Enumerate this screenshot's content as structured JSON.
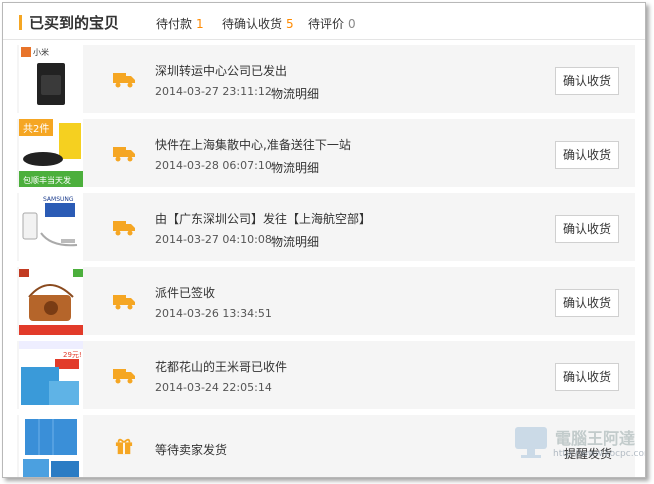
{
  "header": {
    "title": "已买到的宝贝",
    "tabs": [
      {
        "label": "待付款",
        "count": "1"
      },
      {
        "label": "待确认收货",
        "count": "5"
      },
      {
        "label": "待评价",
        "count": "0"
      }
    ]
  },
  "orders": [
    {
      "status": "深圳转运中心公司已发出",
      "time": "2014-03-27 23:11:12",
      "detail": "物流明细",
      "action": "确认收货",
      "icon": "truck-icon",
      "thumb_label": "小米"
    },
    {
      "status": "快件在上海集散中心,准备送往下一站",
      "time": "2014-03-28 06:07:10",
      "detail": "物流明细",
      "action": "确认收货",
      "icon": "truck-icon",
      "thumb_badge": "共2件",
      "thumb_label": "包顺丰当天发"
    },
    {
      "status": "由【广东深圳公司】发往【上海航空部】",
      "time": "2014-03-27 04:10:08",
      "detail": "物流明细",
      "action": "确认收货",
      "icon": "truck-icon",
      "thumb_label": "SAMSUNG"
    },
    {
      "status": "派件已签收",
      "time": "2014-03-26 13:34:51",
      "detail": "",
      "action": "确认收货",
      "icon": "truck-icon"
    },
    {
      "status": "花都花山的王米哥已收件",
      "time": "2014-03-24 22:05:14",
      "detail": "",
      "action": "确认收货",
      "icon": "truck-icon",
      "thumb_label": "29元!"
    },
    {
      "status": "等待卖家发货",
      "time": "",
      "detail": "",
      "action": "提醒发货",
      "icon": "gift-icon"
    }
  ],
  "watermark": {
    "text": "電腦王阿達",
    "url": "http://www.kocpc.com.tw"
  },
  "colors": {
    "accent": "#f5a623",
    "count": "#ff8a00",
    "row_bg": "#f5f5f5"
  }
}
